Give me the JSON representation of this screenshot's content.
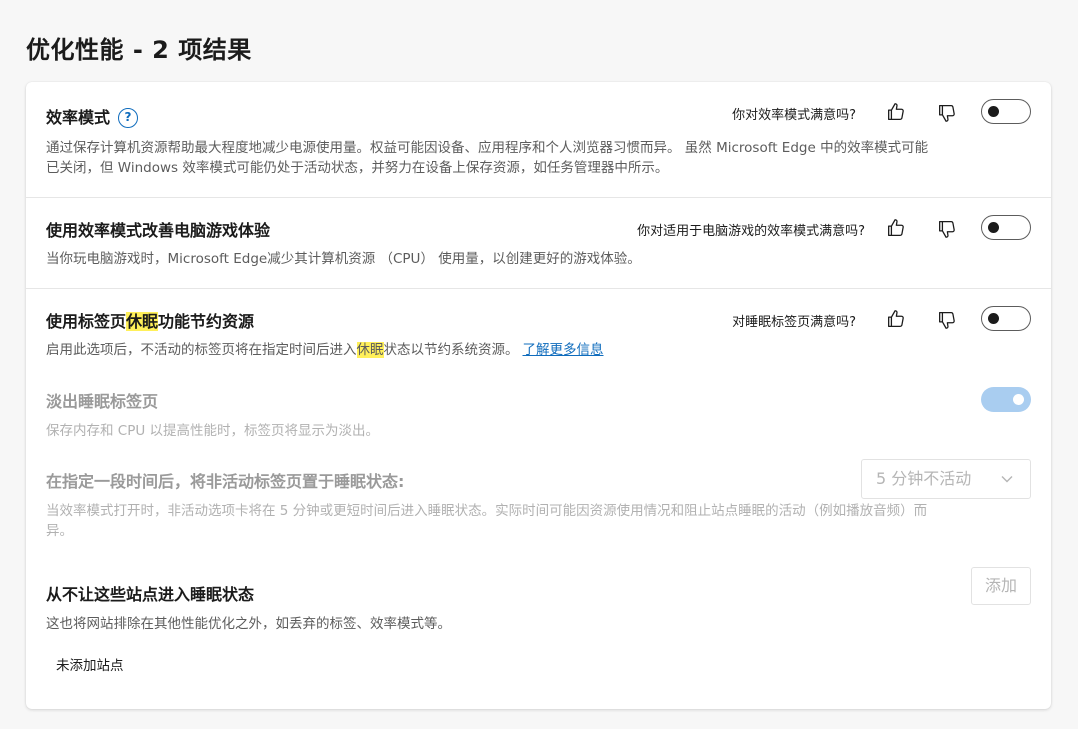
{
  "page": {
    "title": "优化性能 - 2 项结果"
  },
  "efficiency": {
    "title": "效率模式",
    "help_glyph": "?",
    "feedback": "你对效率模式满意吗?",
    "desc_line1": "通过保存计算机资源帮助最大程度地减少电源使用量。权益可能因设备、应用程序和个人浏览器习惯而异。 虽然 Microsoft Edge 中的效率模式可能",
    "desc_line2": "已关闭，但 Windows 效率模式可能仍处于活动状态，并努力在设备上保存资源，如任务管理器中所示。",
    "toggle_on": false
  },
  "gaming": {
    "title": "使用效率模式改善电脑游戏体验",
    "feedback": "你对适用于电脑游戏的效率模式满意吗?",
    "desc": "当你玩电脑游戏时，Microsoft Edge减少其计算机资源 （CPU） 使用量，以创建更好的游戏体验。",
    "toggle_on": false
  },
  "sleeping": {
    "title_pre": "使用标签页",
    "title_hl": "休眠",
    "title_post": "功能节约资源",
    "feedback": "对睡眠标签页满意吗?",
    "desc_pre": "启用此选项后，不活动的标签页将在指定时间后进入",
    "desc_hl": "休眠",
    "desc_post": "状态以节约系统资源。",
    "learn_more": "了解更多信息",
    "toggle_on": false
  },
  "fade": {
    "title": "淡出睡眠标签页",
    "desc": "保存内存和 CPU 以提高性能时，标签页将显示为淡出。",
    "toggle_on": true
  },
  "timeout": {
    "title": "在指定一段时间后，将非活动标签页置于睡眠状态:",
    "selected": "5 分钟不活动",
    "desc_line1": "当效率模式打开时，非活动选项卡将在 5 分钟或更短时间后进入睡眠状态。实际时间可能因资源使用情况和阻止站点睡眠的活动（例如播放音频）而",
    "desc_line2": "异。"
  },
  "never_sleep": {
    "title": "从不让这些站点进入睡眠状态",
    "add_label": "添加",
    "desc": "这也将网站排除在其他性能优化之外，如丢弃的标签、效率模式等。",
    "empty": "未添加站点"
  },
  "colors": {
    "accent": "#0f6cbd",
    "highlight": "#fff05a",
    "toggle_dim_on": "#a9cdf0"
  }
}
